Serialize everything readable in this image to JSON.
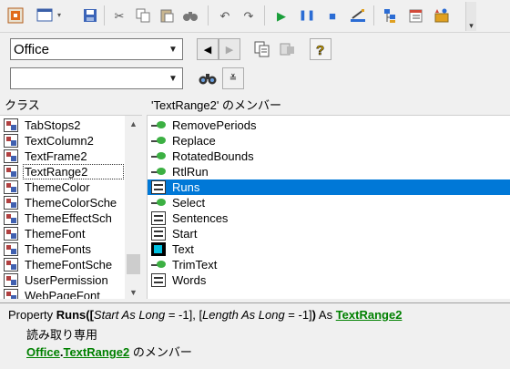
{
  "toolbar": {
    "buttons": [
      "view-object-icon",
      "insert-userform-icon",
      "save-icon",
      "cut-icon",
      "copy-icon",
      "paste-icon",
      "find-icon",
      "undo-icon",
      "redo-icon",
      "run-icon",
      "break-icon",
      "reset-icon",
      "design-mode-icon",
      "project-explorer-icon",
      "properties-icon",
      "toolbox-icon"
    ]
  },
  "library_combo": {
    "value": "Office"
  },
  "search_combo": {
    "value": ""
  },
  "class_pane": {
    "header": "クラス",
    "items": [
      "TabStops2",
      "TextColumn2",
      "TextFrame2",
      "TextRange2",
      "ThemeColor",
      "ThemeColorSche",
      "ThemeEffectSch",
      "ThemeFont",
      "ThemeFonts",
      "ThemeFontSche",
      "UserPermission",
      "WebPageFont"
    ],
    "selected_index": 3
  },
  "member_pane": {
    "header": "'TextRange2' のメンバー",
    "items": [
      {
        "label": "RemovePeriods",
        "kind": "method"
      },
      {
        "label": "Replace",
        "kind": "method"
      },
      {
        "label": "RotatedBounds",
        "kind": "method"
      },
      {
        "label": "RtlRun",
        "kind": "method"
      },
      {
        "label": "Runs",
        "kind": "property"
      },
      {
        "label": "Select",
        "kind": "method"
      },
      {
        "label": "Sentences",
        "kind": "property"
      },
      {
        "label": "Start",
        "kind": "property"
      },
      {
        "label": "Text",
        "kind": "constant"
      },
      {
        "label": "TrimText",
        "kind": "method"
      },
      {
        "label": "Words",
        "kind": "property"
      }
    ],
    "selected_index": 4
  },
  "detail": {
    "kw_property": "Property ",
    "member_name": "Runs",
    "open_paren": "([",
    "p1_name": "Start",
    "as1": " As ",
    "p1_type": "Long",
    "p1_default": " = -1], [",
    "p2_name": "Length",
    "as2": " As ",
    "p2_type": "Long",
    "p2_default": " = -1]",
    "close_paren": ")",
    "as_ret": " As ",
    "return_type": "TextRange2",
    "readonly": "読み取り専用",
    "lib_link": "Office",
    "dot": ".",
    "class_link": "TextRange2",
    "member_of": " のメンバー"
  }
}
